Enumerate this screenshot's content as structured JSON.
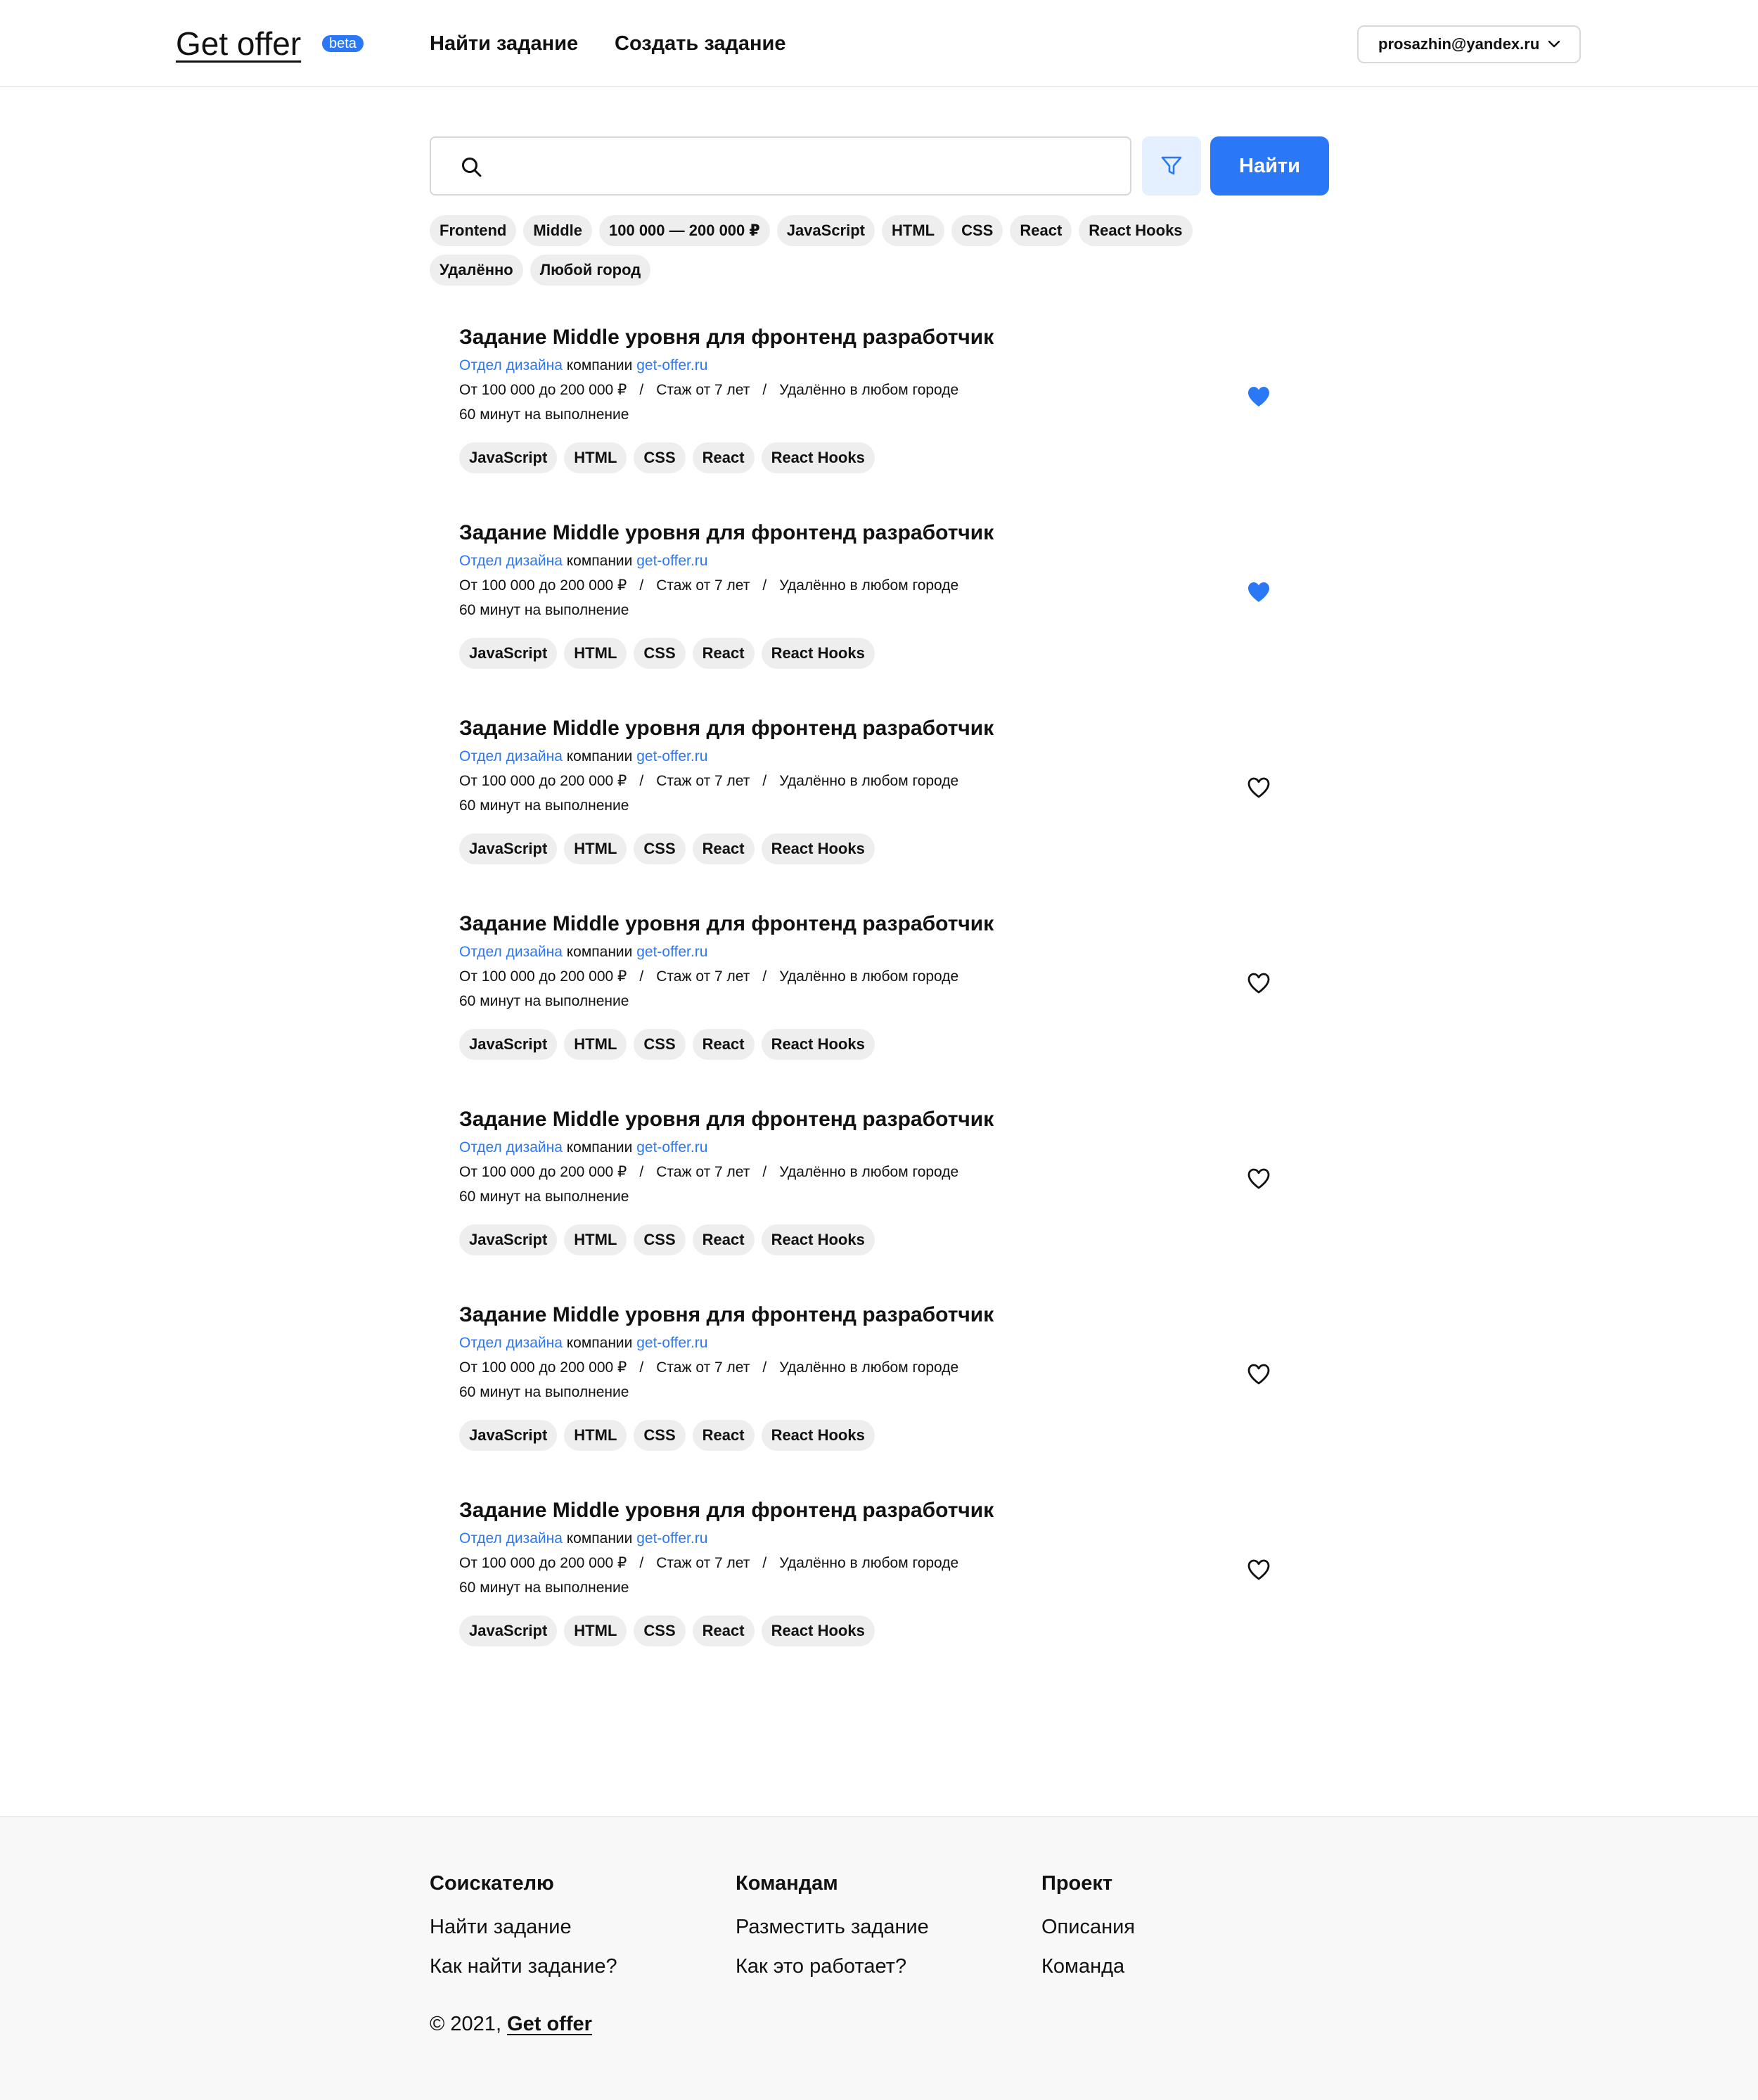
{
  "header": {
    "logo": "Get offer",
    "beta": "beta",
    "nav": [
      "Найти задание",
      "Создать задание"
    ],
    "user_email": "prosazhin@yandex.ru"
  },
  "search": {
    "placeholder": "",
    "value": "",
    "find_label": "Найти",
    "filters": [
      "Frontend",
      "Middle",
      "100 000 — 200 000 ₽",
      "JavaScript",
      "HTML",
      "CSS",
      "React",
      "React Hooks",
      "Удалённо",
      "Любой город"
    ]
  },
  "tasks": [
    {
      "title": "Задание Middle уровня для фронтенд разработчик",
      "dept": "Отдел дизайна",
      "company_word": " компании ",
      "company": "get-offer.ru",
      "salary": "От 100 000 до 200 000 ₽",
      "experience": "Стаж от 7 лет",
      "location": "Удалённо в любом городе",
      "duration": "60 минут на выполнение",
      "tags": [
        "JavaScript",
        "HTML",
        "CSS",
        "React",
        "React Hooks"
      ],
      "favorite": true
    },
    {
      "title": "Задание Middle уровня для фронтенд разработчик",
      "dept": "Отдел дизайна",
      "company_word": " компании ",
      "company": "get-offer.ru",
      "salary": "От 100 000 до 200 000 ₽",
      "experience": "Стаж от 7 лет",
      "location": "Удалённо в любом городе",
      "duration": "60 минут на выполнение",
      "tags": [
        "JavaScript",
        "HTML",
        "CSS",
        "React",
        "React Hooks"
      ],
      "favorite": true
    },
    {
      "title": "Задание Middle уровня для фронтенд разработчик",
      "dept": "Отдел дизайна",
      "company_word": " компании ",
      "company": "get-offer.ru",
      "salary": "От 100 000 до 200 000 ₽",
      "experience": "Стаж от 7 лет",
      "location": "Удалённо в любом городе",
      "duration": "60 минут на выполнение",
      "tags": [
        "JavaScript",
        "HTML",
        "CSS",
        "React",
        "React Hooks"
      ],
      "favorite": false
    },
    {
      "title": "Задание Middle уровня для фронтенд разработчик",
      "dept": "Отдел дизайна",
      "company_word": " компании ",
      "company": "get-offer.ru",
      "salary": "От 100 000 до 200 000 ₽",
      "experience": "Стаж от 7 лет",
      "location": "Удалённо в любом городе",
      "duration": "60 минут на выполнение",
      "tags": [
        "JavaScript",
        "HTML",
        "CSS",
        "React",
        "React Hooks"
      ],
      "favorite": false
    },
    {
      "title": "Задание Middle уровня для фронтенд разработчик",
      "dept": "Отдел дизайна",
      "company_word": " компании ",
      "company": "get-offer.ru",
      "salary": "От 100 000 до 200 000 ₽",
      "experience": "Стаж от 7 лет",
      "location": "Удалённо в любом городе",
      "duration": "60 минут на выполнение",
      "tags": [
        "JavaScript",
        "HTML",
        "CSS",
        "React",
        "React Hooks"
      ],
      "favorite": false
    },
    {
      "title": "Задание Middle уровня для фронтенд разработчик",
      "dept": "Отдел дизайна",
      "company_word": " компании ",
      "company": "get-offer.ru",
      "salary": "От 100 000 до 200 000 ₽",
      "experience": "Стаж от 7 лет",
      "location": "Удалённо в любом городе",
      "duration": "60 минут на выполнение",
      "tags": [
        "JavaScript",
        "HTML",
        "CSS",
        "React",
        "React Hooks"
      ],
      "favorite": false
    },
    {
      "title": "Задание Middle уровня для фронтенд разработчик",
      "dept": "Отдел дизайна",
      "company_word": " компании ",
      "company": "get-offer.ru",
      "salary": "От 100 000 до 200 000 ₽",
      "experience": "Стаж от 7 лет",
      "location": "Удалённо в любом городе",
      "duration": "60 минут на выполнение",
      "tags": [
        "JavaScript",
        "HTML",
        "CSS",
        "React",
        "React Hooks"
      ],
      "favorite": false
    }
  ],
  "footer": {
    "columns": [
      {
        "title": "Соискателю",
        "links": [
          "Найти задание",
          "Как найти задание?"
        ]
      },
      {
        "title": "Командам",
        "links": [
          "Разместить задание",
          "Как это работает?"
        ]
      },
      {
        "title": "Проект",
        "links": [
          "Описания",
          "Команда"
        ]
      }
    ],
    "copyright": "© 2021, ",
    "copyright_brand": "Get offer"
  },
  "colors": {
    "accent": "#2b78f6",
    "chip_bg": "#eeeeee",
    "footer_bg": "#f8f8f8"
  },
  "icons": {
    "search": "search-icon",
    "filter": "filter-icon",
    "heart": "heart-icon",
    "chevron": "chevron-down-icon"
  }
}
